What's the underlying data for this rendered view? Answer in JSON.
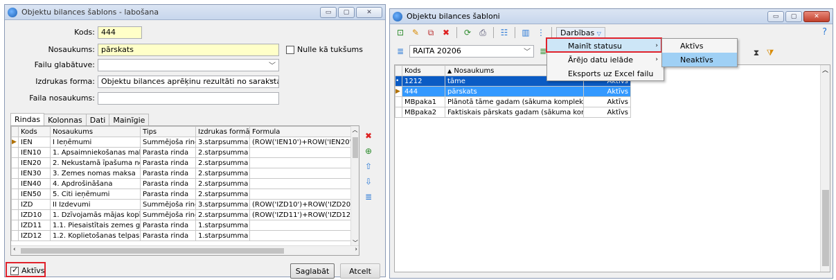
{
  "left": {
    "title": "Objektu bilances šablons - labošana",
    "kods_label": "Kods:",
    "kods_value": "444",
    "nos_label": "Nosaukums:",
    "nos_value": "pārskats",
    "nulle_label": "Nulle kā tukšums",
    "failu_label": "Failu glabātuve:",
    "failu_value": "",
    "izdr_label": "Izdrukas forma:",
    "izdr_value": "Objektu bilances aprēķinu rezultāti no saraksta",
    "faila_label": "Faila nosaukums:",
    "faila_value": "",
    "tabs": [
      "Rindas",
      "Kolonnas",
      "Dati",
      "Mainīgie"
    ],
    "columns": [
      "Kods",
      "Nosaukums",
      "Tips",
      "Izdrukas formāts",
      "Formula"
    ],
    "rows": [
      [
        "IEN",
        "I  Ieņēmumi",
        "Summējoša rinda",
        "3.starpsumma",
        "(ROW('IEN10')+ROW('IEN20')+I"
      ],
      [
        "IEN10",
        "1.  Apsaimniekošanas maksa",
        "Parasta rinda",
        "2.starpsumma",
        ""
      ],
      [
        "IEN20",
        "2.  Nekustamā īpašuma nodoklis",
        "Parasta rinda",
        "2.starpsumma",
        ""
      ],
      [
        "IEN30",
        "3.  Zemes nomas maksa",
        "Parasta rinda",
        "2.starpsumma",
        ""
      ],
      [
        "IEN40",
        "4.  Apdrošināšana",
        "Parasta rinda",
        "2.starpsumma",
        ""
      ],
      [
        "IEN50",
        "5.  Citi ieņēmumi",
        "Parasta rinda",
        "2.starpsumma",
        ""
      ],
      [
        "IZD",
        "II  Izdevumi",
        "Summējoša rinda",
        "3.starpsumma",
        "(ROW('IZD10')+ROW('IZD20')+I"
      ],
      [
        "IZD10",
        "1.  Dzīvojamās mājas kopīpašum...",
        "Summējoša rinda",
        "2.starpsumma",
        "(ROW('IZD11')+ROW('IZD12')+I"
      ],
      [
        "IZD11",
        "1.1.  Piesaistītais zemes gabals",
        "Parasta rinda",
        "1.starpsumma",
        ""
      ],
      [
        "IZD12",
        "1.2.  Koplietošanas telpas",
        "Parasta rinda",
        "1.starpsumma",
        ""
      ]
    ],
    "aktivs_label": "Aktīvs",
    "save_label": "Saglabāt",
    "cancel_label": "Atcelt"
  },
  "right": {
    "title": "Objektu bilances šabloni",
    "darbibas_label": "Darbības",
    "filter_value": "RAITA 20206",
    "columns": [
      "Kods",
      "Nosaukums"
    ],
    "rows": [
      [
        "1212",
        "tāme",
        "Aktīvs"
      ],
      [
        "444",
        "pārskats",
        "Aktīvs"
      ],
      [
        "MBpaka1",
        "Plānotā tāme gadam (sākuma komplekts)",
        "Aktīvs"
      ],
      [
        "MBpaka2",
        "Faktiskais pārskats gadam (sākuma komplekts)",
        "Aktīvs"
      ]
    ],
    "menu": [
      "Mainīt statusu",
      "Ārējo datu ielāde",
      "Eksports uz Excel failu"
    ],
    "submenu": [
      "Aktīvs",
      "Neaktīvs"
    ]
  },
  "colors": {
    "selection": "#3399ff",
    "highlight": "#e0212b"
  }
}
